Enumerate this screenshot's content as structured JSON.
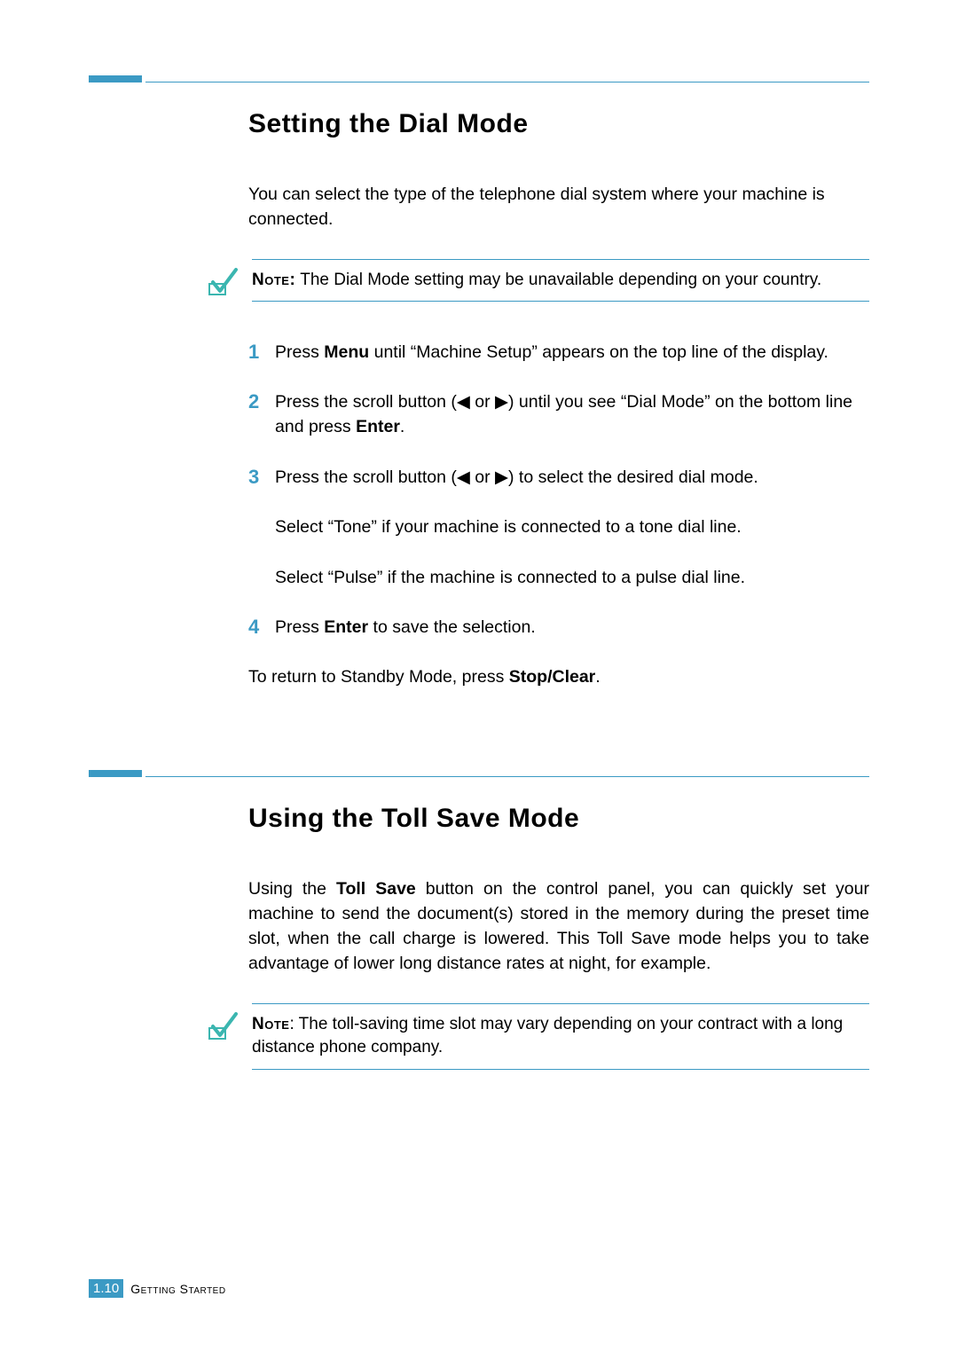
{
  "section1": {
    "heading": "Setting the Dial Mode",
    "intro": "You can select the type of the telephone dial system where your machine is connected.",
    "note_label": "Note:",
    "note_text": " The Dial Mode setting may be unavailable depending on your country.",
    "steps": {
      "s1_pre": "Press ",
      "s1_bold": "Menu",
      "s1_post": " until “Machine Setup” appears on the top line of the display.",
      "s2_pre": "Press the scroll button (◀ or ▶) until you see “Dial Mode” on the bottom line and press ",
      "s2_bold": "Enter",
      "s2_post": ".",
      "s3": "Press the scroll button (◀ or ▶) to select the desired dial mode.",
      "s3_sub1": "Select “Tone” if your machine is connected to a tone dial line.",
      "s3_sub2": "Select “Pulse” if the machine is connected to a pulse dial line.",
      "s4_pre": "Press ",
      "s4_bold": "Enter",
      "s4_post": " to save the selection."
    },
    "return_pre": "To return to Standby Mode, press ",
    "return_bold": "Stop/Clear",
    "return_post": "."
  },
  "section2": {
    "heading": "Using the Toll Save Mode",
    "intro_pre": "Using the ",
    "intro_bold": "Toll Save",
    "intro_post": " button on the control panel, you can quickly set your machine to send the document(s) stored in the memory during the preset time slot, when the call charge is lowered. This Toll Save mode helps you to take advantage of lower long distance rates at night, for example.",
    "note_label": "Note",
    "note_text": ": The toll-saving time slot may vary depending on your contract with a long distance phone company."
  },
  "footer": {
    "page_num": "1.10",
    "label": "Getting Started"
  },
  "nums": {
    "n1": "1",
    "n2": "2",
    "n3": "3",
    "n4": "4"
  }
}
